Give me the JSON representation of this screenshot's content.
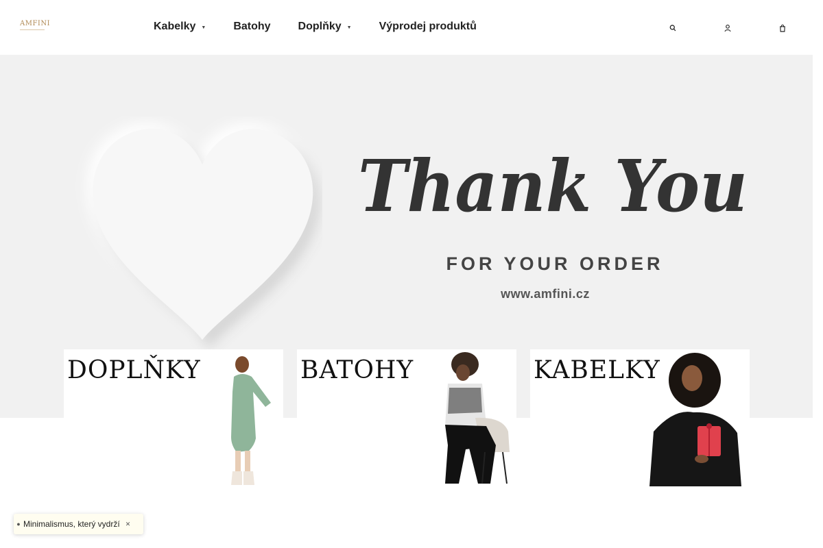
{
  "brand": {
    "logo_text": "AMFINI"
  },
  "nav": {
    "items": [
      {
        "label": "Kabelky",
        "has_dropdown": true
      },
      {
        "label": "Batohy",
        "has_dropdown": false
      },
      {
        "label": "Doplňky",
        "has_dropdown": true
      },
      {
        "label": "Výprodej produktů",
        "has_dropdown": false
      }
    ],
    "caret": "▼"
  },
  "header_icons": [
    "search-icon",
    "user-icon",
    "cart-icon"
  ],
  "hero": {
    "headline": "Thank You",
    "subtitle": "FOR YOUR ORDER",
    "url": "www.amfini.cz"
  },
  "categories": [
    {
      "title": "DOPLŇKY"
    },
    {
      "title": "BATOHY"
    },
    {
      "title": "KABELKY"
    }
  ],
  "promo": {
    "text": "Minimalismus, který vydrží"
  },
  "colors": {
    "hero_bg": "#f1f1f1",
    "logo_gold": "#b08a55",
    "headline": "#333333"
  }
}
